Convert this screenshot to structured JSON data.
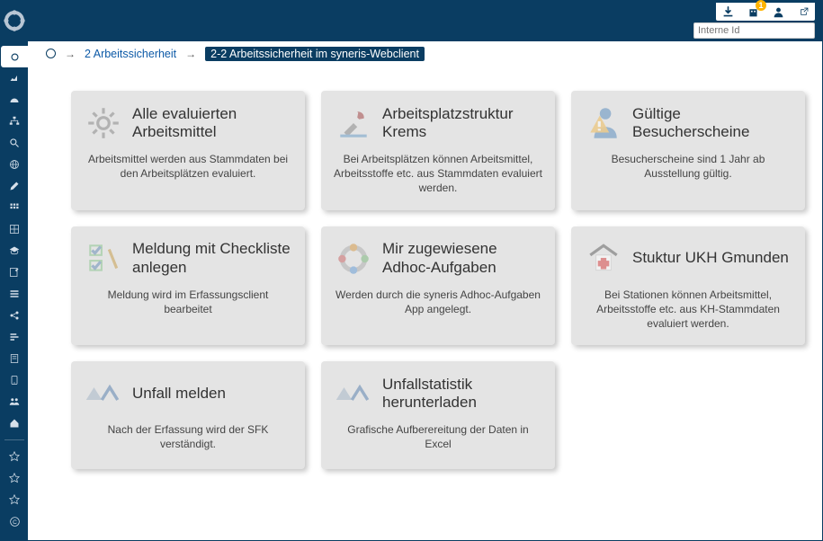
{
  "search": {
    "placeholder": "Interne Id"
  },
  "topbar": {
    "notifications_count": "1"
  },
  "breadcrumb": {
    "level1": "2 Arbeitssicherheit",
    "current": "2-2 Arbeitssicherheit im syneris-Webclient"
  },
  "cards": [
    {
      "title": "Alle evaluierten Arbeitsmittel",
      "desc": "Arbeitsmittel werden aus Stammdaten bei den Arbeitsplätzen evaluiert.",
      "icon": "gear"
    },
    {
      "title": "Arbeitsplatzstruktur Krems",
      "desc": "Bei Arbeitsplätzen können Arbeitsmittel, Arbeitsstoffe etc. aus Stammdaten evaluiert werden.",
      "icon": "tools"
    },
    {
      "title": "Gültige Besucherscheine",
      "desc": "Besucherscheine sind 1 Jahr ab Ausstellung gültig.",
      "icon": "person-warn"
    },
    {
      "title": "Meldung mit Checkliste anlegen",
      "desc": "Meldung wird im Erfassungsclient bearbeitet",
      "icon": "checklist"
    },
    {
      "title": "Mir zugewiesene Adhoc-Aufgaben",
      "desc": "Werden durch die syneris Adhoc-Aufgaben App angelegt.",
      "icon": "ring"
    },
    {
      "title": "Stuktur UKH Gmunden",
      "desc": "Bei Stationen können Arbeitsmittel, Arbeitsstoffe etc. aus KH-Stammdaten evaluiert werden.",
      "icon": "medical"
    },
    {
      "title": "Unfall melden",
      "desc": "Nach der Erfassung wird der SFK verständigt.",
      "icon": "auva"
    },
    {
      "title": "Unfallstatistik herunterladen",
      "desc": "Grafische Aufberereitung der Daten in Excel",
      "icon": "auva"
    }
  ]
}
